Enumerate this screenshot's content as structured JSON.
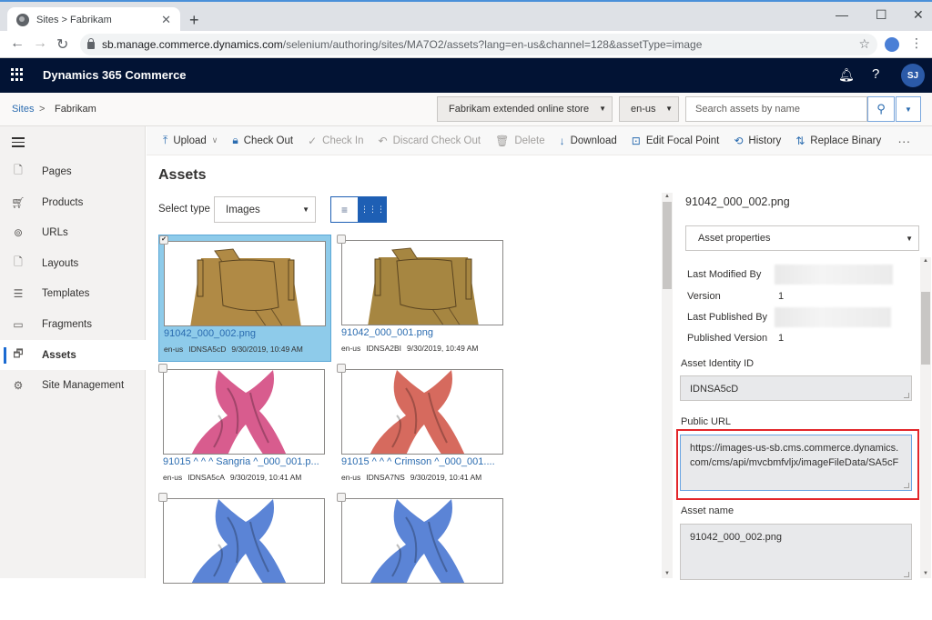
{
  "browser": {
    "tab_title": "Sites > Fabrikam",
    "url_host": "sb.manage.commerce.dynamics.com",
    "url_path": "/selenium/authoring/sites/MA7O2/assets?lang=en-us&channel=128&assetType=image"
  },
  "app": {
    "name": "Dynamics 365 Commerce",
    "user_initials": "SJ"
  },
  "breadcrumb": {
    "root": "Sites",
    "separator": ">",
    "current": "Fabrikam"
  },
  "header_controls": {
    "site_select": "Fabrikam extended online store",
    "locale_select": "en-us",
    "search_placeholder": "Search assets by name"
  },
  "sidebar": {
    "items": [
      {
        "label": "Pages",
        "icon": "page-icon"
      },
      {
        "label": "Products",
        "icon": "cart-icon"
      },
      {
        "label": "URLs",
        "icon": "link-icon"
      },
      {
        "label": "Layouts",
        "icon": "layout-icon"
      },
      {
        "label": "Templates",
        "icon": "template-icon"
      },
      {
        "label": "Fragments",
        "icon": "fragment-icon"
      },
      {
        "label": "Assets",
        "icon": "assets-icon",
        "active": true
      },
      {
        "label": "Site Management",
        "icon": "gear-icon"
      }
    ]
  },
  "toolbar": {
    "upload": "Upload",
    "check_out": "Check Out",
    "check_in": "Check In",
    "discard_check_out": "Discard Check Out",
    "delete": "Delete",
    "download": "Download",
    "edit_focal_point": "Edit Focal Point",
    "history": "History",
    "replace_binary": "Replace Binary",
    "more": "···"
  },
  "main": {
    "title": "Assets",
    "select_type_label": "Select type",
    "select_type_value": "Images",
    "assets": [
      {
        "name": "91042_000_002.png",
        "locale": "en-us",
        "id": "IDNSA5cD",
        "date": "9/30/2019, 10:49 AM",
        "selected": true,
        "kind": "bag",
        "color": "#b08a45"
      },
      {
        "name": "91042_000_001.png",
        "locale": "en-us",
        "id": "IDNSA2BI",
        "date": "9/30/2019, 10:49 AM",
        "selected": false,
        "kind": "bag",
        "color": "#a68641"
      },
      {
        "name": "91015 ^ ^ ^ Sangria ^_000_001.p...",
        "locale": "en-us",
        "id": "IDNSA5cA",
        "date": "9/30/2019, 10:41 AM",
        "selected": false,
        "kind": "scarf",
        "color": "#d85c8e"
      },
      {
        "name": "91015 ^ ^ ^ Crimson ^_000_001....",
        "locale": "en-us",
        "id": "IDNSA7NS",
        "date": "9/30/2019, 10:41 AM",
        "selected": false,
        "kind": "scarf",
        "color": "#d66a5e"
      },
      {
        "name": "",
        "locale": "",
        "id": "",
        "date": "",
        "selected": false,
        "kind": "scarf",
        "color": "#5b84d6"
      },
      {
        "name": "",
        "locale": "",
        "id": "",
        "date": "",
        "selected": false,
        "kind": "scarf",
        "color": "#5b84d6"
      }
    ]
  },
  "details": {
    "title": "91042_000_002.png",
    "section_select": "Asset properties",
    "properties": [
      {
        "label": "Last Modified By",
        "value": "",
        "redacted": true
      },
      {
        "label": "Version",
        "value": "1"
      },
      {
        "label": "Last Published By",
        "value": "",
        "redacted": true
      },
      {
        "label": "Published Version",
        "value": "1"
      }
    ],
    "asset_identity_label": "Asset Identity ID",
    "asset_identity_value": "IDNSA5cD",
    "public_url_label": "Public URL",
    "public_url_value": "https://images-us-sb.cms.commerce.dynamics.com/cms/api/mvcbmfvljx/imageFileData/SA5cF",
    "asset_name_label": "Asset name",
    "asset_name_value": "91042_000_002.png"
  }
}
